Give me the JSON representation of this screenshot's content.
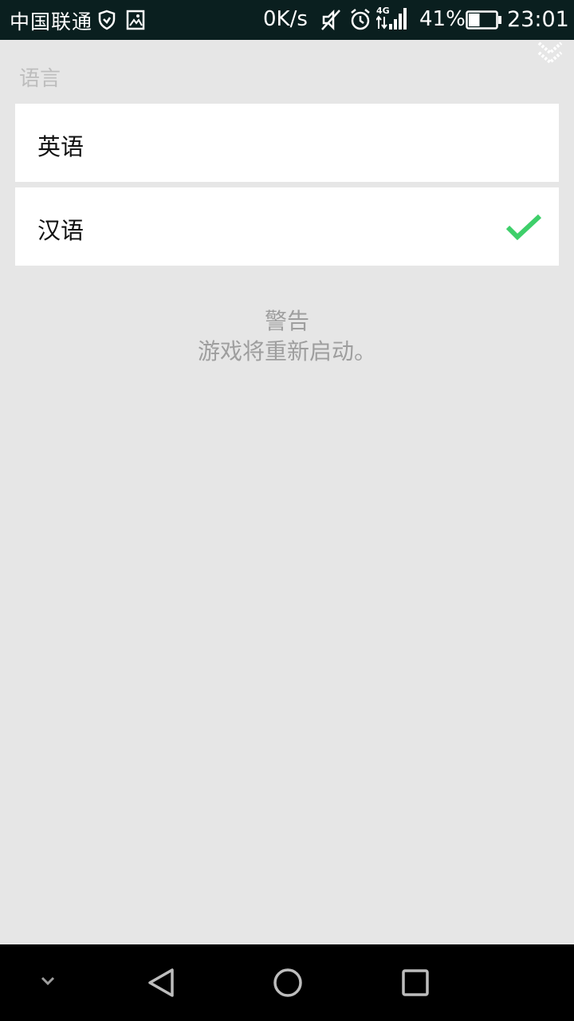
{
  "status_bar": {
    "carrier": "中国联通",
    "net_speed": "0K/s",
    "network_type": "4G",
    "battery_percent": "41%",
    "battery_level": 0.41,
    "time": "23:01",
    "icons": [
      "shield-icon",
      "image-icon",
      "mute-icon",
      "alarm-icon",
      "signal-icon",
      "battery-icon"
    ]
  },
  "page": {
    "section_title": "语言",
    "options": [
      {
        "label": "英语",
        "selected": false
      },
      {
        "label": "汉语",
        "selected": true
      }
    ],
    "warning_title": "警告",
    "warning_message": "游戏将重新启动。"
  },
  "nav_bar": {
    "icons": [
      "chevron-down-icon",
      "back-icon",
      "home-icon",
      "recents-icon"
    ]
  },
  "colors": {
    "status_bar_bg": "#0a1f1f",
    "page_bg": "#e6e6e6",
    "check_green": "#3ecf6a",
    "muted_text": "#9e9e9e"
  }
}
